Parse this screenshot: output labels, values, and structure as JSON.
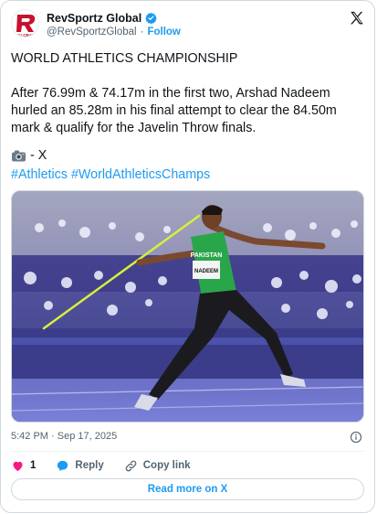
{
  "author": {
    "display_name": "RevSportz Global",
    "handle": "@RevSportzGlobal",
    "separator": "·",
    "follow_label": "Follow",
    "logo_text": "GLOBAL"
  },
  "tweet": {
    "headline": "WORLD ATHLETICS CHAMPIONSHIP",
    "body_line1": "After 76.99m & 74.17m in the first two, Arshad Nadeem",
    "body_line2": "hurled an 85.28m in his final attempt to clear the 84.50m",
    "body_line3": "mark & qualify for the Javelin Throw finals.",
    "credit": "- X",
    "hashtags": "#Athletics #WorldAthleticsChamps"
  },
  "media": {
    "jersey_text": "PAKISTAN",
    "bib_text": "NADEEM"
  },
  "meta": {
    "timestamp": "5:42 PM · Sep 17, 2025"
  },
  "actions": {
    "like_count": "1",
    "reply_label": "Reply",
    "copy_label": "Copy link"
  },
  "read_more_label": "Read more on X",
  "colors": {
    "accent": "#1d9bf0",
    "like": "#f91880",
    "text": "#0f1419",
    "muted": "#536471"
  }
}
